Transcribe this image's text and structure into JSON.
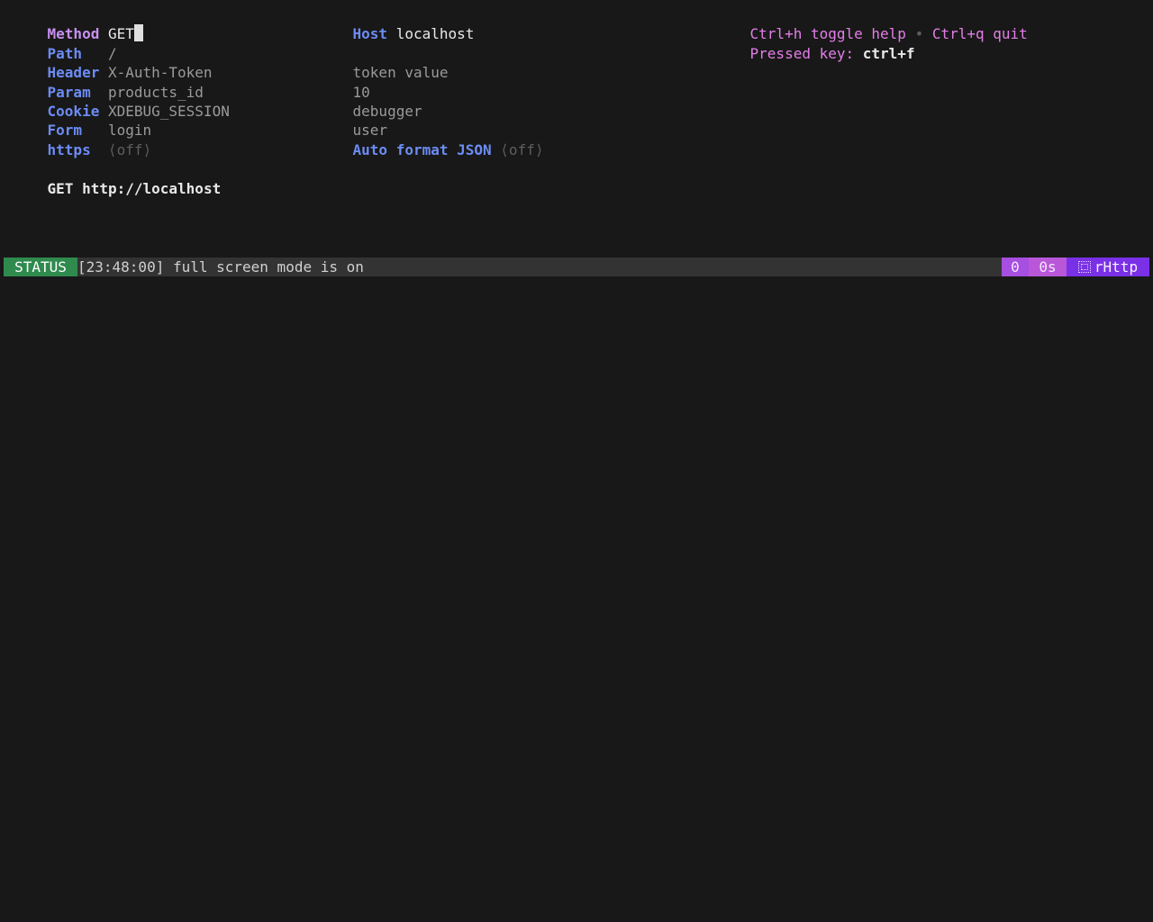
{
  "request": {
    "method": {
      "label": "Method",
      "value": "GET"
    },
    "host": {
      "label": "Host",
      "value": "localhost"
    },
    "path": {
      "label": "Path",
      "value": "/"
    },
    "header": {
      "label": "Header",
      "key": "X-Auth-Token",
      "value": "token value"
    },
    "param": {
      "label": "Param",
      "key": "products_id",
      "value": "10"
    },
    "cookie": {
      "label": "Cookie",
      "key": "XDEBUG_SESSION",
      "value": "debugger"
    },
    "form": {
      "label": "Form",
      "key": "login",
      "value": "user"
    },
    "https": {
      "label": "https",
      "state": "⟨off⟩"
    },
    "auto_format_json": {
      "label": "Auto format JSON",
      "state": "⟨off⟩"
    }
  },
  "help": {
    "toggle_help": "Ctrl+h toggle help",
    "separator": "•",
    "quit": "Ctrl+q quit",
    "pressed_label": "Pressed key:",
    "pressed_value": "ctrl+f"
  },
  "summary": {
    "method": "GET",
    "url": "http://localhost"
  },
  "status": {
    "tag": "STATUS",
    "message": "[23:48:00] full screen mode is on",
    "count": "0",
    "time": "0s",
    "brand": "rHttp",
    "brand_icon": "grid-icon"
  },
  "colors": {
    "background": "#181818",
    "label_purple": "#c88ff0",
    "label_blue": "#6c8cf5",
    "status_green": "#2f8a4e",
    "brand_purple": "#7a30e6"
  }
}
